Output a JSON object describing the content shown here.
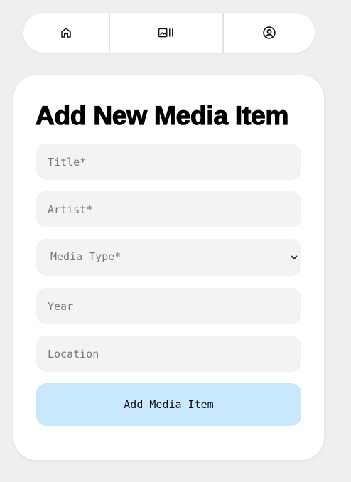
{
  "nav": {
    "items": [
      {
        "icon": "home-icon"
      },
      {
        "icon": "media-library-icon"
      },
      {
        "icon": "user-profile-icon"
      }
    ]
  },
  "form": {
    "title": "Add New Media Item",
    "fields": {
      "title_placeholder": "Title*",
      "artist_placeholder": "Artist*",
      "media_type_selected": "Media Type*",
      "year_placeholder": "Year",
      "location_placeholder": "Location"
    },
    "submit_label": "Add Media Item"
  },
  "colors": {
    "page_background": "#efefef",
    "card_background": "#ffffff",
    "field_background": "#f3f3f3",
    "button_background": "#cae8fd"
  }
}
